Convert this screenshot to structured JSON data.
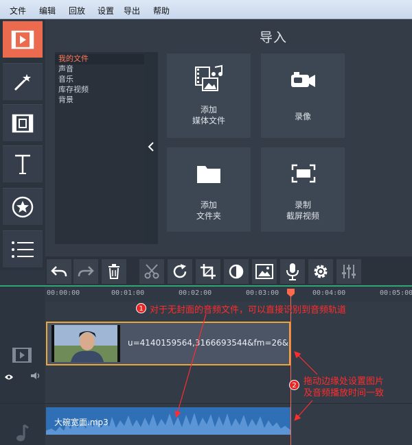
{
  "menu": [
    "文件",
    "编辑",
    "回放",
    "设置",
    "导出",
    "帮助"
  ],
  "import_panel": {
    "title": "导入",
    "file_list": [
      {
        "label": "我的文件",
        "selected": true
      },
      {
        "label": "声音",
        "selected": false
      },
      {
        "label": "音乐",
        "selected": false
      },
      {
        "label": "库存视频",
        "selected": false
      },
      {
        "label": "背景",
        "selected": false
      }
    ],
    "tiles": [
      {
        "line1": "添加",
        "line2": "媒体文件",
        "icon": "add-media-icon"
      },
      {
        "line1": "录像",
        "line2": "",
        "icon": "camera-icon"
      },
      {
        "line1": "添加",
        "line2": "文件夹",
        "icon": "folder-icon"
      },
      {
        "line1": "录制",
        "line2": "截屏视频",
        "icon": "screen-capture-icon"
      }
    ]
  },
  "rail_tools": [
    "import-icon",
    "magic-wand-icon",
    "film-transitions-icon",
    "text-icon",
    "sticker-star-icon",
    "list-icon"
  ],
  "toolbar_tools": [
    "undo-icon",
    "redo-icon",
    "delete-icon",
    "cut-icon",
    "rotate-icon",
    "crop-icon",
    "color-adjust-icon",
    "image-icon",
    "microphone-icon",
    "settings-icon",
    "equalizer-icon"
  ],
  "timeline": {
    "ruler": [
      "00:00:00",
      "00:01:00",
      "00:02:00",
      "00:03:00",
      "00:04:00",
      "00:05:00"
    ],
    "video_clip_name": "u=4140159564,3166693544&fm=26&",
    "audio_clip_name": "大碗宽面.mp3"
  },
  "annotations": {
    "note1_number": "1",
    "note1": "对于无封面的音频文件，可以直接识别到音频轨道",
    "note2_number": "2",
    "note2_line1": "拖动边缘处设置图片",
    "note2_line2": "及音频播放时间一致"
  },
  "colors": {
    "accent": "#ec6a4e",
    "clip_border": "#e8a93c",
    "audio": "#2f6fb6",
    "timeline_line": "#2fa877",
    "annotation": "#ff2d2d"
  }
}
